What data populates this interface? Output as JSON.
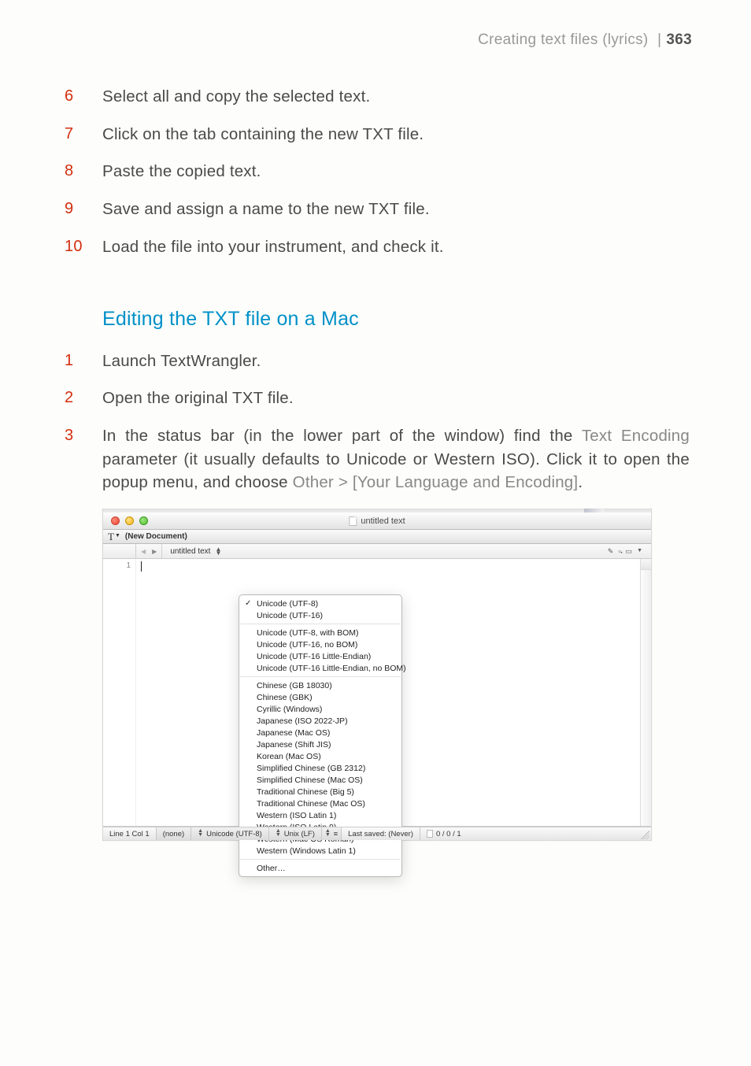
{
  "header": {
    "section_title": "Creating text files (lyrics)",
    "page_number": "363"
  },
  "steps_a": [
    {
      "num": "6",
      "text": "Select all and copy the selected text."
    },
    {
      "num": "7",
      "text": "Click on the tab containing the new TXT file."
    },
    {
      "num": "8",
      "text": "Paste the copied text."
    },
    {
      "num": "9",
      "text": "Save and assign a name to the new TXT file."
    },
    {
      "num": "10",
      "text": "Load the file into your instrument, and check it."
    }
  ],
  "heading": "Editing the TXT file on a Mac",
  "steps_b": [
    {
      "num": "1",
      "text": "Launch TextWrangler."
    },
    {
      "num": "2",
      "text": "Open the original TXT file."
    }
  ],
  "step3": {
    "num": "3",
    "pre": "In the status bar (in the lower part of the window) find the ",
    "ui1": "Text Encoding",
    "mid": " parameter (it usually defaults to Unicode or Western ISO). Click it to open the popup menu, and choose ",
    "ui2": "Other > [Your Language and Encoding]",
    "post": "."
  },
  "shot": {
    "window_title": "untitled text",
    "drawer": "(New Document)",
    "tab": "untitled text",
    "line_num": "1",
    "encoding_groups": [
      {
        "items": [
          "Unicode (UTF-8)",
          "Unicode (UTF-16)"
        ],
        "checked_index": 0
      },
      {
        "items": [
          "Unicode (UTF-8, with BOM)",
          "Unicode (UTF-16, no BOM)",
          "Unicode (UTF-16 Little-Endian)",
          "Unicode (UTF-16 Little-Endian, no BOM)"
        ]
      },
      {
        "items": [
          "Chinese (GB 18030)",
          "Chinese (GBK)",
          "Cyrillic (Windows)",
          "Japanese (ISO 2022-JP)",
          "Japanese (Mac OS)",
          "Japanese (Shift JIS)",
          "Korean (Mac OS)",
          "Simplified Chinese (GB 2312)",
          "Simplified Chinese (Mac OS)",
          "Traditional Chinese (Big 5)",
          "Traditional Chinese (Mac OS)",
          "Western (ISO Latin 1)",
          "Western (ISO Latin 9)",
          "Western (Mac OS Roman)",
          "Western (Windows Latin 1)"
        ]
      },
      {
        "items": [
          "Other…"
        ]
      }
    ],
    "status": {
      "pos": "Line 1 Col 1",
      "lang": "(none)",
      "encoding": "Unicode (UTF-8)",
      "endings": "Unix (LF)",
      "saved": "Last saved: (Never)",
      "counts": "0 / 0 / 1"
    }
  }
}
